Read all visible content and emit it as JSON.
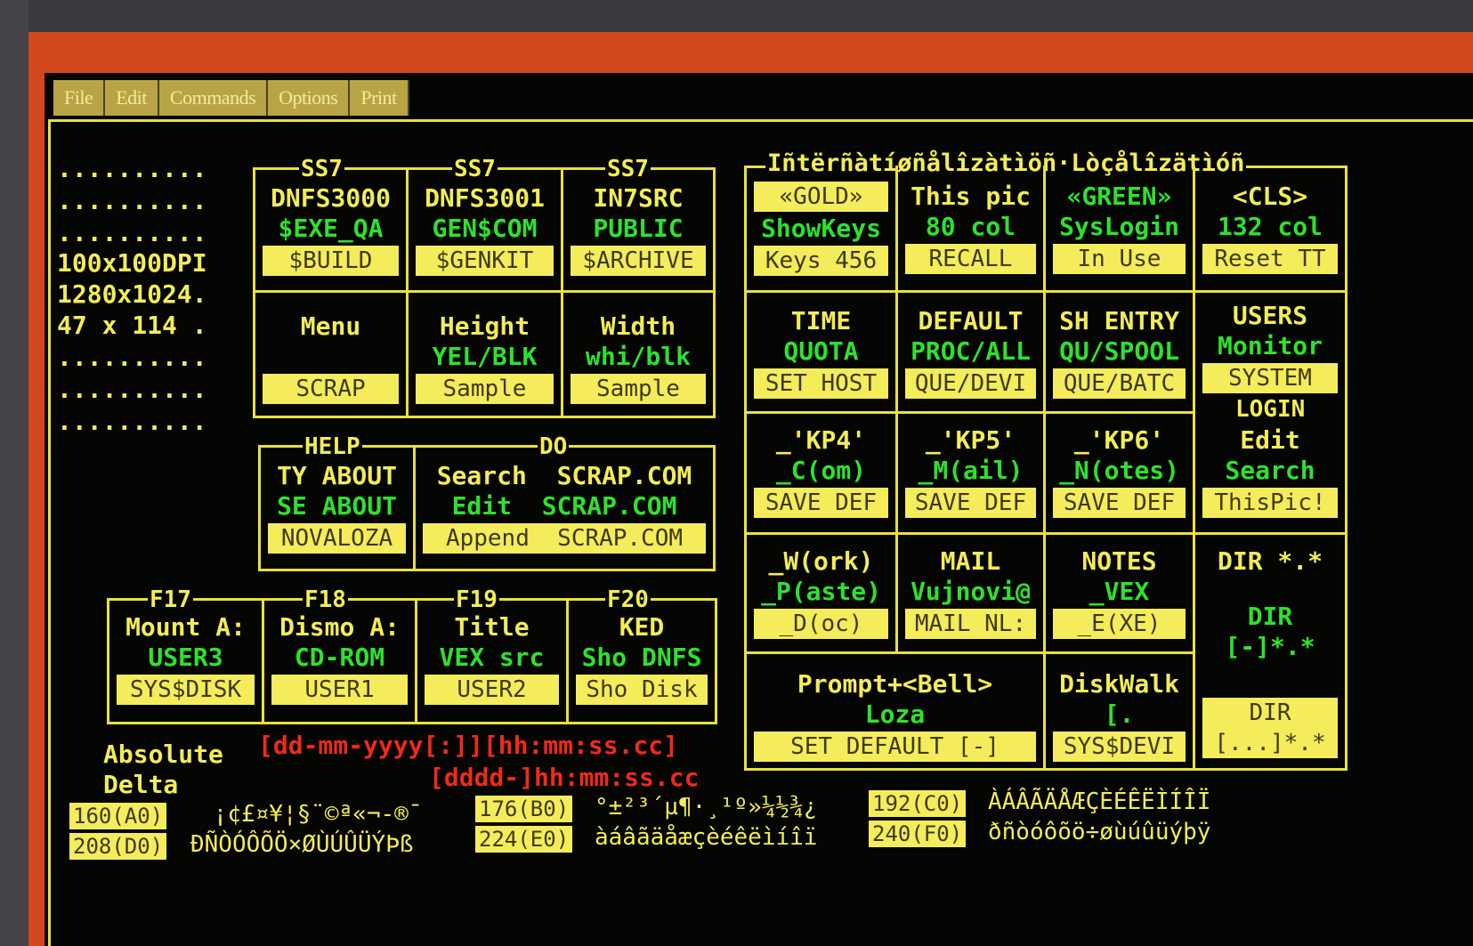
{
  "menu": [
    "File",
    "Edit",
    "Commands",
    "Options",
    "Print"
  ],
  "sidebar": {
    "dots": "..........",
    "line_dpi": "100x100DPI",
    "line_res": "1280x1024.",
    "line_size": "47 x 114 ."
  },
  "ss7": {
    "labels": [
      "SS7",
      "SS7",
      "SS7"
    ],
    "cells": [
      {
        "l1": "DNFS3000",
        "l2": "$EXE_QA",
        "btn": "$BUILD"
      },
      {
        "l1": "DNFS3001",
        "l2": "GEN$COM",
        "btn": "$GENKIT"
      },
      {
        "l1": "IN7SRC",
        "l2": "PUBLIC",
        "btn": "$ARCHIVE"
      },
      {
        "l1": "Menu",
        "l2": "",
        "btn": "SCRAP"
      },
      {
        "l1": "Height",
        "l2": "YEL/BLK",
        "btn": "Sample"
      },
      {
        "l1": "Width",
        "l2": "whi/blk",
        "btn": "Sample"
      }
    ]
  },
  "help": {
    "label": "HELP",
    "l1": "TY ABOUT",
    "l2": "SE ABOUT",
    "btn": "NOVALOZA"
  },
  "do": {
    "label": "DO",
    "l1": "Search  SCRAP.COM",
    "l2": "Edit  SCRAP.COM",
    "btn": "Append  SCRAP.COM"
  },
  "fkeys": {
    "labels": [
      "F17",
      "F18",
      "F19",
      "F20"
    ],
    "cells": [
      {
        "l1": "Mount A:",
        "l2": "USER3",
        "btn": "SYS$DISK"
      },
      {
        "l1": "Dismo A:",
        "l2": "CD-ROM",
        "btn": "USER1"
      },
      {
        "l1": "Title",
        "l2": "VEX src",
        "btn": "USER2"
      },
      {
        "l1": "KED",
        "l2": "Sho DNFS",
        "btn": "Sho Disk"
      }
    ]
  },
  "intl_title": "Iñtërñàtíøñålîzàtìöñ·Lòçålîzätìóñ",
  "grid": {
    "row1": [
      {
        "l1": "«GOLD»",
        "l2": "ShowKeys",
        "btn": "Keys 456",
        "l1btn": true
      },
      {
        "l1": "This pic",
        "l2": "80 col",
        "btn": "RECALL"
      },
      {
        "l1": "«GREEN»",
        "l2": "SysLogin",
        "btn": "In Use",
        "l1green": true
      },
      {
        "l1": "<CLS>",
        "l2": "132 col",
        "btn": "Reset TT"
      }
    ],
    "row2": [
      {
        "l1": "TIME",
        "l2": "QUOTA",
        "btn": "SET HOST"
      },
      {
        "l1": "DEFAULT",
        "l2": "PROC/ALL",
        "btn": "QUE/DEVI"
      },
      {
        "l1": "SH ENTRY",
        "l2": "QU/SPOOL",
        "btn": "QUE/BATC"
      },
      {
        "l1": "USERS",
        "l2": "Monitor",
        "btn": "SYSTEM"
      }
    ],
    "login_label": "LOGIN",
    "row3": [
      {
        "l1": "_'KP4'",
        "l2": "_C(om)",
        "btn": "SAVE DEF"
      },
      {
        "l1": "_'KP5'",
        "l2": "_M(ail)",
        "btn": "SAVE DEF"
      },
      {
        "l1": "_'KP6'",
        "l2": "_N(otes)",
        "btn": "SAVE DEF"
      },
      {
        "l1": "Edit",
        "l2": "Search",
        "btn": "ThisPic!"
      }
    ],
    "row4": [
      {
        "l1": "_W(ork)",
        "l2": "_P(aste)",
        "btn": "_D(oc)"
      },
      {
        "l1": "MAIL",
        "l2": "Vujnovi@",
        "btn": "MAIL NL:"
      },
      {
        "l1": "NOTES",
        "l2": "_VEX",
        "btn": "_E(XE)"
      }
    ],
    "dir": {
      "l1": "DIR *.*",
      "l2a": "DIR",
      "l2b": "[-]*.*",
      "btn1": "DIR",
      "btn2": "[...]*.*"
    },
    "row5": [
      {
        "l1": "Prompt+<Bell>",
        "l2": "Loza",
        "btn": "SET DEFAULT [-]"
      },
      {
        "l1": "DiskWalk",
        "l2": "[.",
        "btn": "SYS$DEVI"
      }
    ]
  },
  "time": {
    "abs_label": "Absolute",
    "abs_fmt": "[dd-mm-yyyy[:]][hh:mm:ss.cc]",
    "delta_label": "Delta",
    "delta_fmt": "[dddd-]hh:mm:ss.cc"
  },
  "charset": {
    "h1": "160(A0)",
    "c1": " ¡¢£¤¥¦§¨©ª«¬-®¯",
    "h2": "176(B0)",
    "c2": "°±²³´µ¶·¸¹º»¼½¾¿",
    "h3": "192(C0)",
    "c3": "ÀÁÂÃÄÅÆÇÈÉÊËÌÍÎÏ",
    "h4": "208(D0)",
    "c4": "ÐÑÒÓÔÕÖ×ØÙÚÛÜÝÞß",
    "h5": "224(E0)",
    "c5": "àáâãäåæçèéêëìíîï",
    "h6": "240(F0)",
    "c6": "ðñòóôõö÷øùúûüýþÿ"
  }
}
